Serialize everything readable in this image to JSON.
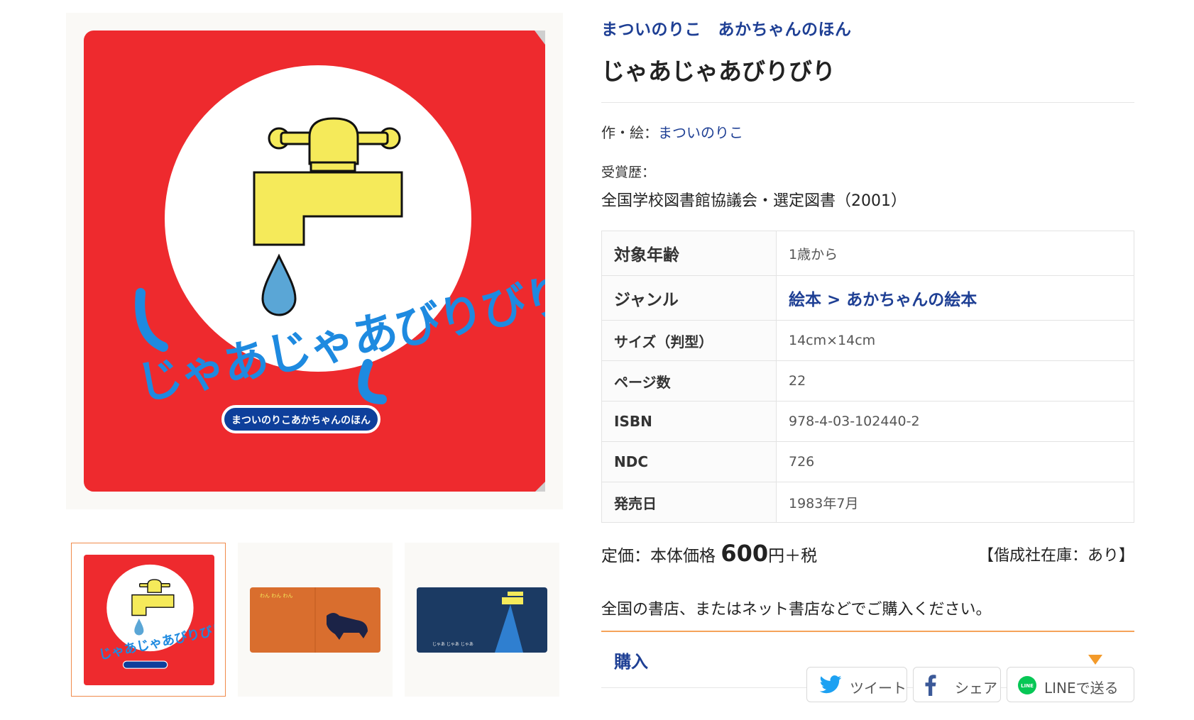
{
  "cover": {
    "title_art": "じゃあじゃあびりびり",
    "series_badge": "まついのりこあかちゃんのほん",
    "colors": {
      "red": "#ee2a2e",
      "blue": "#1e8ae0",
      "yellow": "#f5ea5a",
      "drop": "#5aa6d6"
    }
  },
  "thumbnails": [
    {
      "name": "cover",
      "caption": "",
      "active": true
    },
    {
      "name": "spread-dog",
      "caption": "わん わん わん",
      "active": false
    },
    {
      "name": "spread-faucet",
      "caption": "じゃあ じゃあ じゃあ",
      "active": false
    }
  ],
  "book": {
    "series": "まついのりこ　あかちゃんのほん",
    "title": "じゃあじゃあびりびり",
    "author_label": "作・絵：",
    "author": "まついのりこ",
    "award_label": "受賞歴：",
    "award": "全国学校図書館協議会・選定図書（2001）"
  },
  "specs": [
    {
      "key": "対象年齢",
      "value": "1歳から",
      "link": false
    },
    {
      "key": "ジャンル",
      "value": "絵本 > あかちゃんの絵本",
      "link": true
    },
    {
      "key": "サイズ（判型）",
      "value": "14cm×14cm",
      "link": false
    },
    {
      "key": "ページ数",
      "value": "22",
      "link": false
    },
    {
      "key": "ISBN",
      "value": "978-4-03-102440-2",
      "link": false
    },
    {
      "key": "NDC",
      "value": "726",
      "link": false
    },
    {
      "key": "発売日",
      "value": "1983年7月",
      "link": false
    }
  ],
  "price": {
    "prefix": "定価：本体価格 ",
    "amount": "600",
    "suffix": "円＋税",
    "stock": "【偕成社在庫：あり】"
  },
  "where_to_buy": "全国の書店、またはネット書店などでご購入ください。",
  "buy": {
    "label": "購入",
    "icon": "triangle-down-icon",
    "accent": "#f39a2a"
  },
  "share": {
    "tweet": "ツイート",
    "facebook": "シェア",
    "line": "LINEで送る",
    "colors": {
      "twitter": "#1da1f2",
      "facebook": "#3b5998",
      "line": "#06c755"
    }
  }
}
